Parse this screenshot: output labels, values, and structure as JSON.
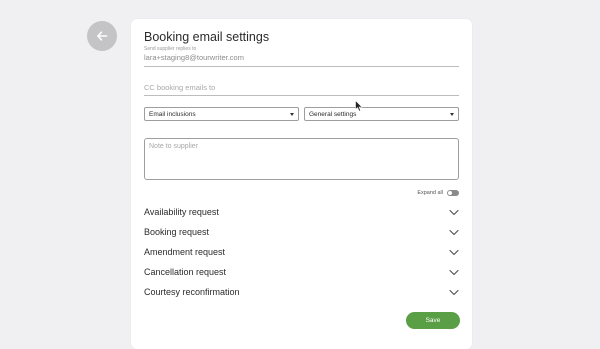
{
  "header": {
    "title": "Booking email settings"
  },
  "reply_field": {
    "label": "Send supplier replies to",
    "value": "lara+staging8@tourwriter.com"
  },
  "cc_field": {
    "placeholder": "CC booking emails to"
  },
  "selects": {
    "email_inclusions": "Email inclusions",
    "general_settings": "General settings"
  },
  "note": {
    "placeholder": "Note to supplier"
  },
  "expand": {
    "label": "Expand all",
    "on": false
  },
  "sections": [
    {
      "label": "Availability request"
    },
    {
      "label": "Booking request"
    },
    {
      "label": "Amendment request"
    },
    {
      "label": "Cancellation request"
    },
    {
      "label": "Courtesy reconfirmation"
    }
  ],
  "actions": {
    "save_label": "Save"
  },
  "colors": {
    "accent": "#5a9e45",
    "background": "#f0f0f2",
    "back_button": "#c4c4c6"
  }
}
